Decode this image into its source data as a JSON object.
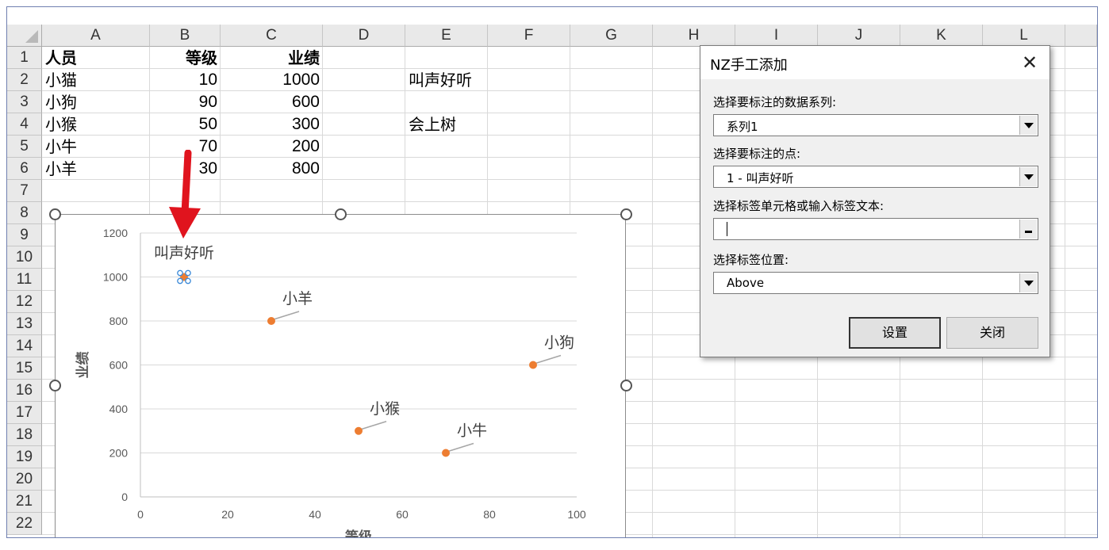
{
  "sheet": {
    "columns": [
      "A",
      "B",
      "C",
      "D",
      "E",
      "F",
      "G",
      "H",
      "I",
      "J",
      "K",
      "L"
    ],
    "rows": [
      "1",
      "2",
      "3",
      "4",
      "5",
      "6",
      "7",
      "8",
      "9",
      "10",
      "11",
      "12",
      "13",
      "14",
      "15",
      "16",
      "17",
      "18",
      "19",
      "20",
      "21",
      "22"
    ],
    "headers": {
      "a1": "人员",
      "b1": "等级",
      "c1": "业绩"
    },
    "data_rows": [
      {
        "name": "小猫",
        "level": "10",
        "perf": "1000"
      },
      {
        "name": "小狗",
        "level": "90",
        "perf": "600"
      },
      {
        "name": "小猴",
        "level": "50",
        "perf": "300"
      },
      {
        "name": "小牛",
        "level": "70",
        "perf": "200"
      },
      {
        "name": "小羊",
        "level": "30",
        "perf": "800"
      }
    ],
    "e2": "叫声好听",
    "e4": "会上树"
  },
  "chart_data": {
    "type": "scatter",
    "ylabel": "业绩",
    "xlabel": "等级",
    "xlim": [
      0,
      100
    ],
    "ylim": [
      0,
      1200
    ],
    "x_ticks": [
      "0",
      "20",
      "40",
      "60",
      "80",
      "100"
    ],
    "y_ticks": [
      "0",
      "200",
      "400",
      "600",
      "800",
      "1000",
      "1200"
    ],
    "points": [
      {
        "x": 10,
        "y": 1000,
        "label": "叫声好听",
        "selected": true
      },
      {
        "x": 90,
        "y": 600,
        "label": "小狗"
      },
      {
        "x": 50,
        "y": 300,
        "label": "小猴"
      },
      {
        "x": 70,
        "y": 200,
        "label": "小牛"
      },
      {
        "x": 30,
        "y": 800,
        "label": "小羊"
      }
    ],
    "marker_color": "#ed7d31",
    "grid": true
  },
  "dialog": {
    "title": "NZ手工添加",
    "series_label": "选择要标注的数据系列:",
    "series_value": "系列1",
    "point_label": "选择要标注的点:",
    "point_value": "1 - 叫声好听",
    "text_label": "选择标签单元格或输入标签文本:",
    "text_value": "",
    "position_label": "选择标签位置:",
    "position_value": "Above",
    "set_button": "设置",
    "close_button": "关闭"
  },
  "colors": {
    "arrow": "#e0141e",
    "accent": "#ed7d31"
  }
}
